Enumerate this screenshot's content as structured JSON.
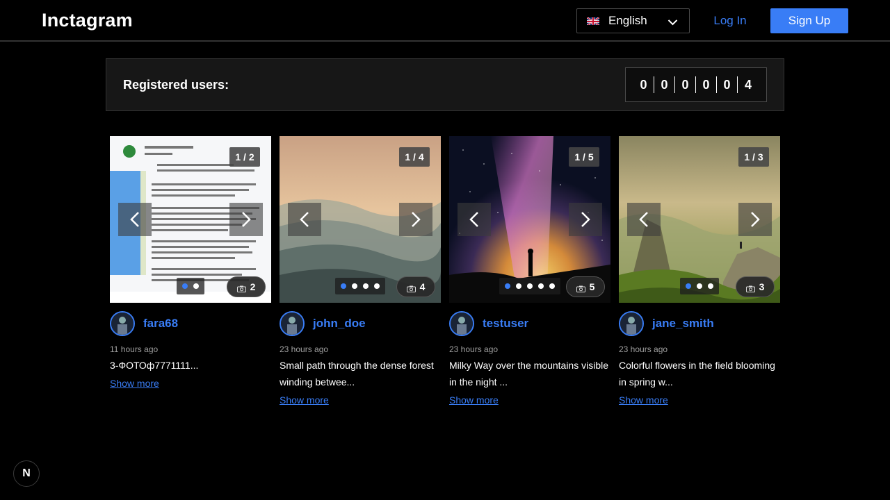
{
  "header": {
    "logo": "Inctagram",
    "language": "English",
    "login_label": "Log In",
    "signup_label": "Sign Up",
    "accent_color": "#397df6"
  },
  "registered": {
    "label": "Registered users:",
    "digits": [
      "0",
      "0",
      "0",
      "0",
      "0",
      "4"
    ]
  },
  "posts": [
    {
      "username": "fara68",
      "time": "11 hours ago",
      "description": "3-ФОТОф7771111...",
      "show_more": "Show more",
      "slide_counter": "1 / 2",
      "photo_count": "2",
      "total_slides": 2,
      "active_slide": 1
    },
    {
      "username": "john_doe",
      "time": "23 hours ago",
      "description": "Small path through the dense forest winding betwee...",
      "show_more": "Show more",
      "slide_counter": "1 / 4",
      "photo_count": "4",
      "total_slides": 4,
      "active_slide": 1
    },
    {
      "username": "testuser",
      "time": "23 hours ago",
      "description": "Milky Way over the mountains visible in the night ...",
      "show_more": "Show more",
      "slide_counter": "1 / 5",
      "photo_count": "5",
      "total_slides": 5,
      "active_slide": 1
    },
    {
      "username": "jane_smith",
      "time": "23 hours ago",
      "description": "Colorful flowers in the field blooming in spring w...",
      "show_more": "Show more",
      "slide_counter": "1 / 3",
      "photo_count": "3",
      "total_slides": 3,
      "active_slide": 1
    }
  ],
  "footer": {
    "next_badge": "N"
  }
}
